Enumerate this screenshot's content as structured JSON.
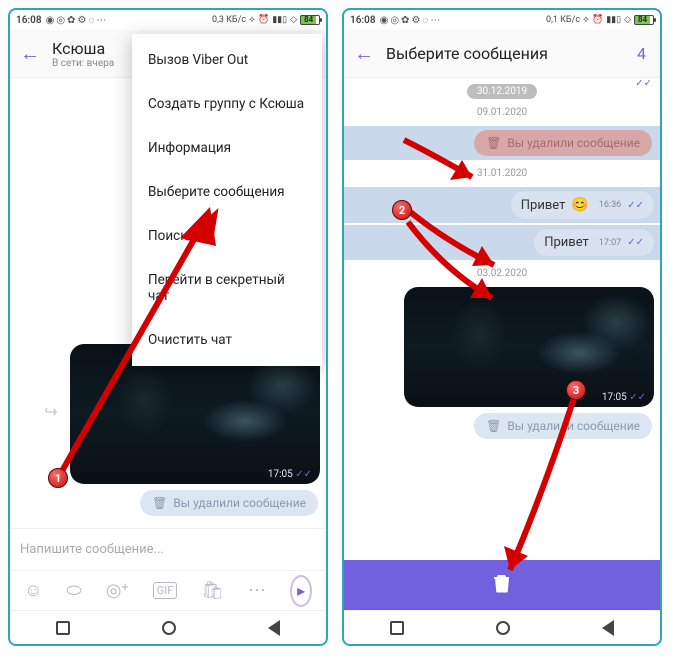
{
  "status": {
    "time": "16:08",
    "net_speed": "0,3 КБ/с",
    "battery_pct": "84"
  },
  "status2": {
    "time": "16:08",
    "net_speed": "0,1 КБ/с",
    "battery_pct": "84"
  },
  "left": {
    "header": {
      "name": "Ксюша",
      "sub": "В сети: вчера"
    },
    "menu": {
      "items": [
        "Вызов Viber Out",
        "Создать группу с Ксюша",
        "Информация",
        "Выберите сообщения",
        "Поиск",
        "Перейти в секретный чат",
        "Очистить чат"
      ]
    },
    "photo_time": "17:05",
    "deleted_text": "Вы удалили сообщение",
    "input_placeholder": "Напишите сообщение..."
  },
  "right": {
    "header": {
      "title": "Выберите сообщения",
      "count": "4"
    },
    "date_chip": "30.12.2019",
    "dates": [
      "09.01.2020",
      "31.01.2020",
      "03.02.2020"
    ],
    "deleted_sel": "Вы удалили сообщение",
    "msg1": {
      "text": "Привет",
      "time": "16:36"
    },
    "msg2": {
      "text": "Привет",
      "time": "17:07"
    },
    "photo_time": "17:05",
    "deleted_text": "Вы удалили сообщение"
  },
  "markers": {
    "m1": "1",
    "m2": "2",
    "m3": "3"
  }
}
